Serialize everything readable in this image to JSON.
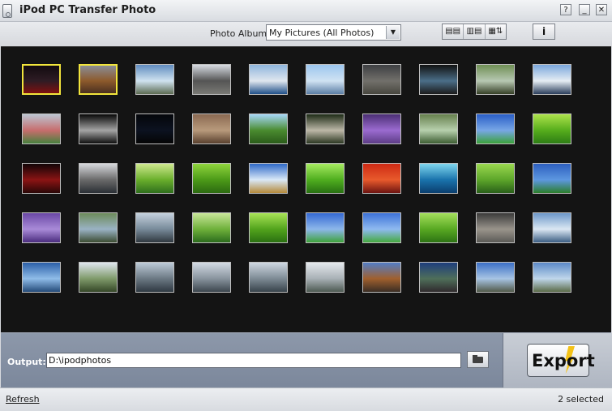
{
  "window": {
    "title": "iPod PC Transfer Photo",
    "buttons": {
      "help": "?",
      "minimize": "_",
      "close": "✕"
    }
  },
  "toolbar": {
    "album_label": "Photo Album:",
    "album_selected": "My Pictures (All Photos)",
    "view_buttons": [
      "▤▤",
      "▥▤",
      "▦⇅"
    ],
    "info_label": "i"
  },
  "gallery": {
    "rows": [
      [
        {
          "top": "#120b10",
          "mid": "#2e1c24",
          "bot": "#7f1010",
          "selected": true
        },
        {
          "top": "#8a8d96",
          "mid": "#8d5a2c",
          "bot": "#4a2f20",
          "selected": true
        },
        {
          "top": "#5f8cc0",
          "mid": "#cfe2ef",
          "bot": "#5c6b52",
          "selected": false
        },
        {
          "top": "#d7dbe2",
          "mid": "#555",
          "bot": "#7a7a75",
          "selected": false
        },
        {
          "top": "#8fb6dd",
          "mid": "#dfe6ee",
          "bot": "#1f4f88",
          "selected": false
        },
        {
          "top": "#9cc6ef",
          "mid": "#d0e2f2",
          "bot": "#5b7ea5",
          "selected": false
        },
        {
          "top": "#3d3f42",
          "mid": "#72706b",
          "bot": "#48473f",
          "selected": false
        },
        {
          "top": "#111",
          "mid": "#4b6e88",
          "bot": "#1b1b1b",
          "selected": false
        },
        {
          "top": "#6f8f54",
          "mid": "#b7c8b2",
          "bot": "#364027",
          "selected": false
        },
        {
          "top": "#7aa7dc",
          "mid": "#e5edf3",
          "bot": "#2a3d5b",
          "selected": false
        }
      ],
      [
        {
          "top": "#bcc6d3",
          "mid": "#c76d6d",
          "bot": "#46813d",
          "selected": false
        },
        {
          "top": "#060606",
          "mid": "#a5a5a5",
          "bot": "#0e0e0e",
          "selected": false
        },
        {
          "top": "#04060a",
          "mid": "#0c1220",
          "bot": "#050505",
          "selected": false
        },
        {
          "top": "#8b6a52",
          "mid": "#b89a7c",
          "bot": "#59402e",
          "selected": false
        },
        {
          "top": "#a7d8f8",
          "mid": "#4a8b2f",
          "bot": "#2a5b1a",
          "selected": false
        },
        {
          "top": "#1d2b16",
          "mid": "#bdb8a8",
          "bot": "#2c3722",
          "selected": false
        },
        {
          "top": "#4b2f74",
          "mid": "#9b6bd0",
          "bot": "#5c3c86",
          "selected": false
        },
        {
          "top": "#66804d",
          "mid": "#b7d0ad",
          "bot": "#3d5d32",
          "selected": false
        },
        {
          "top": "#295ec7",
          "mid": "#78a7e6",
          "bot": "#3aa13a",
          "selected": false
        },
        {
          "top": "#aee24b",
          "mid": "#56ad1c",
          "bot": "#2d7d15",
          "selected": false
        }
      ],
      [
        {
          "top": "#100406",
          "mid": "#8b1414",
          "bot": "#2a0707",
          "selected": false
        },
        {
          "top": "#d7d9dd",
          "mid": "#6a6a6a",
          "bot": "#2a2f35",
          "selected": false
        },
        {
          "top": "#cfe88f",
          "mid": "#6aaf2c",
          "bot": "#2f6f1d",
          "selected": false
        },
        {
          "top": "#8fd43d",
          "mid": "#4c9a18",
          "bot": "#2c6a11",
          "selected": false
        },
        {
          "top": "#2e69c8",
          "mid": "#d9e8f7",
          "bot": "#b58a3a",
          "selected": false
        },
        {
          "top": "#a6ea5f",
          "mid": "#4fae1f",
          "bot": "#287012",
          "selected": false
        },
        {
          "top": "#cd2a14",
          "mid": "#e85a2c",
          "bot": "#6d1411",
          "selected": false
        },
        {
          "top": "#7fd7ee",
          "mid": "#1a73ac",
          "bot": "#0b3e6e",
          "selected": false
        },
        {
          "top": "#9ad84f",
          "mid": "#5da62a",
          "bot": "#29601a",
          "selected": false
        },
        {
          "top": "#2d5fbf",
          "mid": "#5d97e0",
          "bot": "#2b7e2b",
          "selected": false
        }
      ],
      [
        {
          "top": "#6a48a6",
          "mid": "#a98bd8",
          "bot": "#4a2c7e",
          "selected": false
        },
        {
          "top": "#6d8b5a",
          "mid": "#9ab2c4",
          "bot": "#3b4c32",
          "selected": false
        },
        {
          "top": "#c5d1de",
          "mid": "#778a99",
          "bot": "#30383f",
          "selected": false
        },
        {
          "top": "#c9e69a",
          "mid": "#6eb03a",
          "bot": "#2c6c1d",
          "selected": false
        },
        {
          "top": "#a8e356",
          "mid": "#52a31c",
          "bot": "#2a7012",
          "selected": false
        },
        {
          "top": "#3469d3",
          "mid": "#8db7ea",
          "bot": "#3ea23a",
          "selected": false
        },
        {
          "top": "#3d72d7",
          "mid": "#8fbaf0",
          "bot": "#45a93f",
          "selected": false
        },
        {
          "top": "#a4df5c",
          "mid": "#58a822",
          "bot": "#2d7314",
          "selected": false
        },
        {
          "top": "#3b3b3b",
          "mid": "#99948b",
          "bot": "#5b5a56",
          "selected": false
        },
        {
          "top": "#6c97c9",
          "mid": "#dbe7f3",
          "bot": "#3b5e83",
          "selected": false
        }
      ],
      [
        {
          "top": "#2b5fa8",
          "mid": "#8fbce8",
          "bot": "#244a78",
          "selected": false
        },
        {
          "top": "#dfe6ee",
          "mid": "#7f9a6a",
          "bot": "#354728",
          "selected": false
        },
        {
          "top": "#bdcbd8",
          "mid": "#6b7883",
          "bot": "#2f3942",
          "selected": false
        },
        {
          "top": "#d3dbe4",
          "mid": "#88939d",
          "bot": "#3c464e",
          "selected": false
        },
        {
          "top": "#cfd8e2",
          "mid": "#7d8a94",
          "bot": "#38434b",
          "selected": false
        },
        {
          "top": "#e5e9ed",
          "mid": "#a8b0b5",
          "bot": "#4d5a52",
          "selected": false
        },
        {
          "top": "#537ec6",
          "mid": "#a0602e",
          "bot": "#3a2d24",
          "selected": false
        },
        {
          "top": "#1f3e7d",
          "mid": "#4f6f5a",
          "bot": "#302a2d",
          "selected": false
        },
        {
          "top": "#3b6fc6",
          "mid": "#a7c4e3",
          "bot": "#525a4a",
          "selected": false
        },
        {
          "top": "#5b89c7",
          "mid": "#bfd6ea",
          "bot": "#5b6b48",
          "selected": false
        }
      ]
    ]
  },
  "output": {
    "label": "Output:",
    "path": "D:\\ipodphotos"
  },
  "export_label": "Export",
  "status": {
    "refresh_label": "Refresh",
    "selected_text": "2 selected"
  }
}
